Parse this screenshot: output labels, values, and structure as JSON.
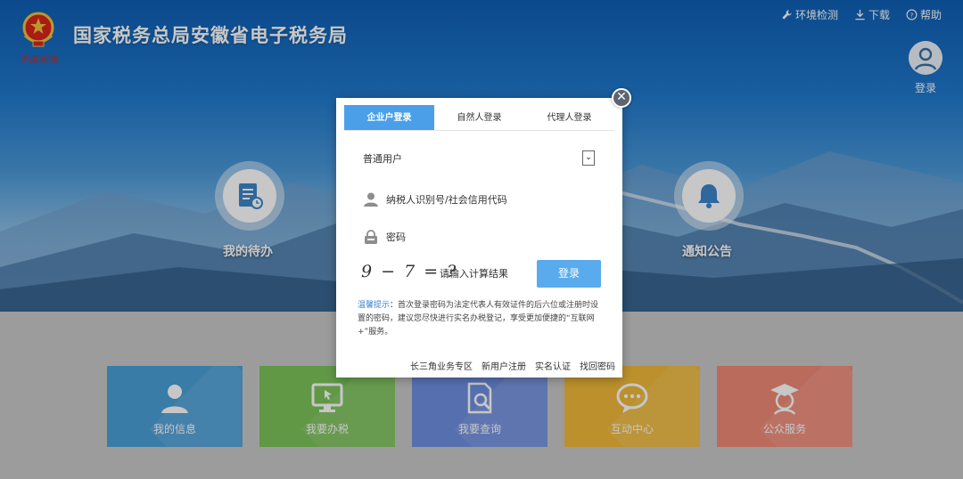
{
  "header": {
    "site_title": "国家税务总局安徽省电子税务局",
    "seal_text": "中国税务",
    "links": [
      {
        "icon": "wrench-icon",
        "label": "环境检测"
      },
      {
        "icon": "download-icon",
        "label": "下载"
      },
      {
        "icon": "help-icon",
        "label": "帮助"
      }
    ],
    "login_label": "登录"
  },
  "hero": {
    "todo_label": "我的待办",
    "notice_label": "通知公告"
  },
  "tiles": [
    {
      "label": "我的信息",
      "color": "#4a9fd8",
      "icon": "user-icon"
    },
    {
      "label": "我要办税",
      "color": "#7cc35a",
      "icon": "monitor-icon"
    },
    {
      "label": "我要查询",
      "color": "#6f8fe0",
      "icon": "search-doc-icon"
    },
    {
      "label": "互动中心",
      "color": "#f0b93a",
      "icon": "chat-icon"
    },
    {
      "label": "公众服务",
      "color": "#ef8a76",
      "icon": "graduate-icon"
    }
  ],
  "modal": {
    "tabs": [
      {
        "label": "企业户登录",
        "active": true
      },
      {
        "label": "自然人登录",
        "active": false
      },
      {
        "label": "代理人登录",
        "active": false
      }
    ],
    "user_type": "普通用户",
    "taxpayer_placeholder": "纳税人识别号/社会信用代码",
    "password_placeholder": "密码",
    "captcha": "9 − 7 = ?",
    "captcha_placeholder": "请输入计算结果",
    "login_button": "登录",
    "tip_label": "温馨提示",
    "tip_text": "：首次登录密码为法定代表人有效证件的后六位或注册时设置的密码，建议您尽快进行实名办税登记，享受更加便捷的“互联网+”服务。",
    "links": [
      "长三角业务专区",
      "新用户注册",
      "实名认证",
      "找回密码"
    ]
  }
}
